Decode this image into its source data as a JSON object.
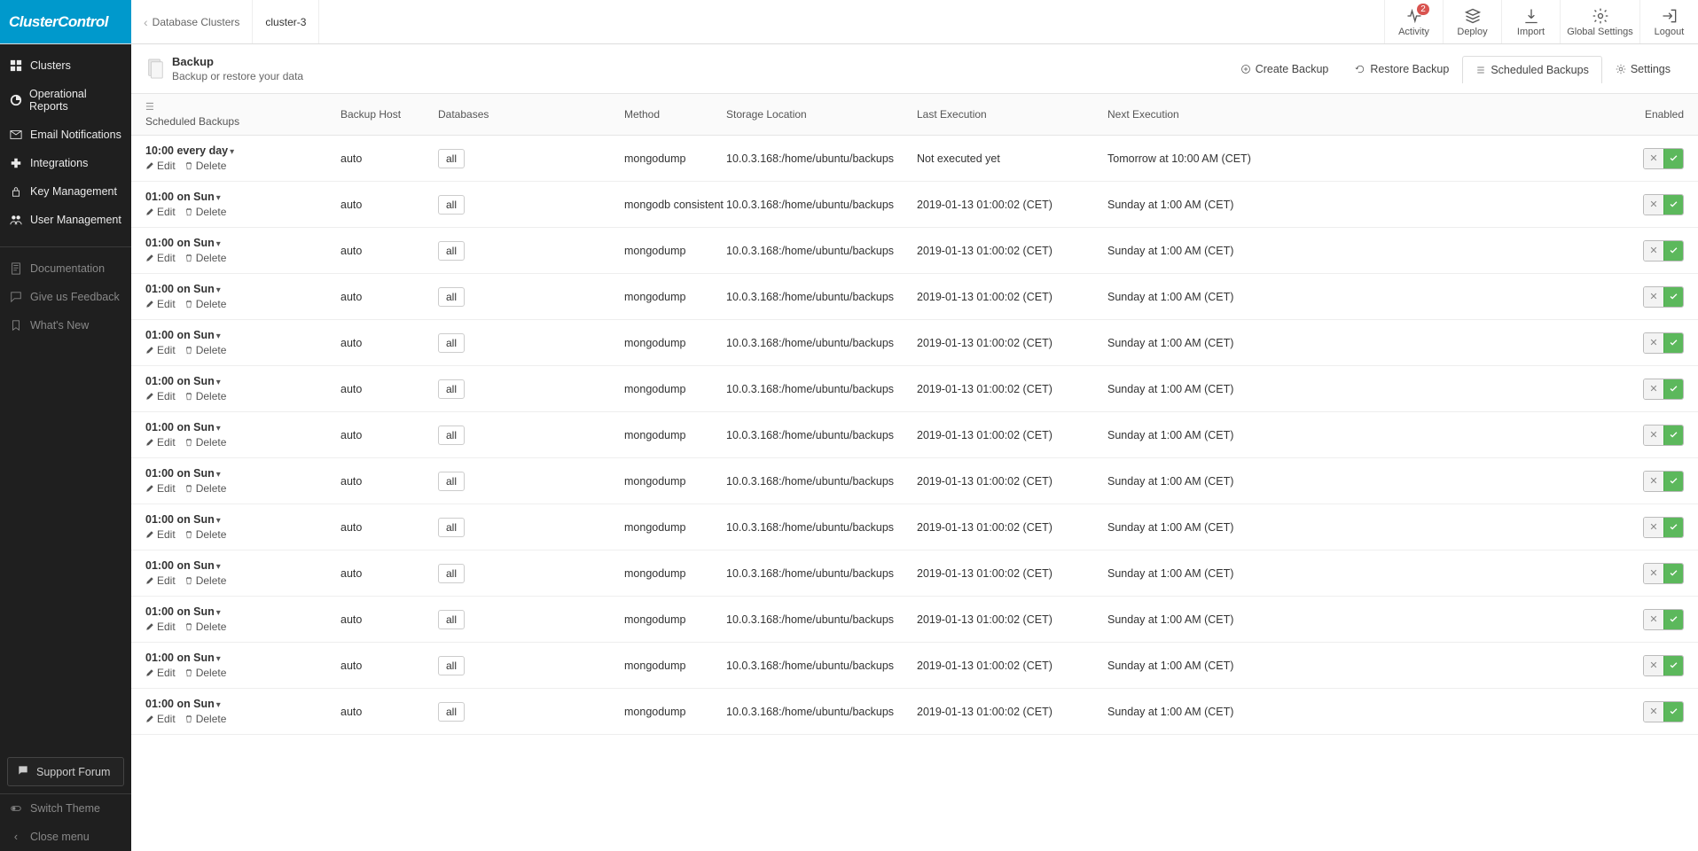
{
  "brand": "ClusterControl",
  "breadcrumb": {
    "back": "Database Clusters",
    "current": "cluster-3"
  },
  "topActions": {
    "activity": "Activity",
    "activityBadge": "2",
    "deploy": "Deploy",
    "import": "Import",
    "globalSettings": "Global Settings",
    "logout": "Logout"
  },
  "sidebar": {
    "primary": [
      {
        "label": "Clusters",
        "icon": "clusters"
      },
      {
        "label": "Operational Reports",
        "icon": "reports"
      },
      {
        "label": "Email Notifications",
        "icon": "email"
      },
      {
        "label": "Integrations",
        "icon": "integrations"
      },
      {
        "label": "Key Management",
        "icon": "key"
      },
      {
        "label": "User Management",
        "icon": "users"
      }
    ],
    "secondary": [
      {
        "label": "Documentation",
        "icon": "doc"
      },
      {
        "label": "Give us Feedback",
        "icon": "feedback"
      },
      {
        "label": "What's New",
        "icon": "new"
      }
    ],
    "supportForum": "Support Forum",
    "switchTheme": "Switch Theme",
    "closeMenu": "Close menu"
  },
  "page": {
    "title": "Backup",
    "subtitle": "Backup or restore your data"
  },
  "tabs": {
    "create": "Create Backup",
    "restore": "Restore Backup",
    "scheduled": "Scheduled Backups",
    "settings": "Settings"
  },
  "table": {
    "headers": {
      "scheduled": "Scheduled Backups",
      "host": "Backup Host",
      "databases": "Databases",
      "method": "Method",
      "storage": "Storage Location",
      "last": "Last Execution",
      "next": "Next Execution",
      "enabled": "Enabled"
    },
    "rowActions": {
      "edit": "Edit",
      "delete": "Delete"
    },
    "rows": [
      {
        "schedule": "10:00 every day",
        "host": "auto",
        "db": "all",
        "method": "mongodump",
        "storage": "10.0.3.168:/home/ubuntu/backups",
        "last": "Not executed yet",
        "next": "Tomorrow at 10:00 AM (CET)"
      },
      {
        "schedule": "01:00 on Sun",
        "host": "auto",
        "db": "all",
        "method": "mongodb consistent",
        "storage": "10.0.3.168:/home/ubuntu/backups",
        "last": "2019-01-13 01:00:02 (CET)",
        "next": "Sunday at 1:00 AM (CET)"
      },
      {
        "schedule": "01:00 on Sun",
        "host": "auto",
        "db": "all",
        "method": "mongodump",
        "storage": "10.0.3.168:/home/ubuntu/backups",
        "last": "2019-01-13 01:00:02 (CET)",
        "next": "Sunday at 1:00 AM (CET)"
      },
      {
        "schedule": "01:00 on Sun",
        "host": "auto",
        "db": "all",
        "method": "mongodump",
        "storage": "10.0.3.168:/home/ubuntu/backups",
        "last": "2019-01-13 01:00:02 (CET)",
        "next": "Sunday at 1:00 AM (CET)"
      },
      {
        "schedule": "01:00 on Sun",
        "host": "auto",
        "db": "all",
        "method": "mongodump",
        "storage": "10.0.3.168:/home/ubuntu/backups",
        "last": "2019-01-13 01:00:02 (CET)",
        "next": "Sunday at 1:00 AM (CET)"
      },
      {
        "schedule": "01:00 on Sun",
        "host": "auto",
        "db": "all",
        "method": "mongodump",
        "storage": "10.0.3.168:/home/ubuntu/backups",
        "last": "2019-01-13 01:00:02 (CET)",
        "next": "Sunday at 1:00 AM (CET)"
      },
      {
        "schedule": "01:00 on Sun",
        "host": "auto",
        "db": "all",
        "method": "mongodump",
        "storage": "10.0.3.168:/home/ubuntu/backups",
        "last": "2019-01-13 01:00:02 (CET)",
        "next": "Sunday at 1:00 AM (CET)"
      },
      {
        "schedule": "01:00 on Sun",
        "host": "auto",
        "db": "all",
        "method": "mongodump",
        "storage": "10.0.3.168:/home/ubuntu/backups",
        "last": "2019-01-13 01:00:02 (CET)",
        "next": "Sunday at 1:00 AM (CET)"
      },
      {
        "schedule": "01:00 on Sun",
        "host": "auto",
        "db": "all",
        "method": "mongodump",
        "storage": "10.0.3.168:/home/ubuntu/backups",
        "last": "2019-01-13 01:00:02 (CET)",
        "next": "Sunday at 1:00 AM (CET)"
      },
      {
        "schedule": "01:00 on Sun",
        "host": "auto",
        "db": "all",
        "method": "mongodump",
        "storage": "10.0.3.168:/home/ubuntu/backups",
        "last": "2019-01-13 01:00:02 (CET)",
        "next": "Sunday at 1:00 AM (CET)"
      },
      {
        "schedule": "01:00 on Sun",
        "host": "auto",
        "db": "all",
        "method": "mongodump",
        "storage": "10.0.3.168:/home/ubuntu/backups",
        "last": "2019-01-13 01:00:02 (CET)",
        "next": "Sunday at 1:00 AM (CET)"
      },
      {
        "schedule": "01:00 on Sun",
        "host": "auto",
        "db": "all",
        "method": "mongodump",
        "storage": "10.0.3.168:/home/ubuntu/backups",
        "last": "2019-01-13 01:00:02 (CET)",
        "next": "Sunday at 1:00 AM (CET)"
      },
      {
        "schedule": "01:00 on Sun",
        "host": "auto",
        "db": "all",
        "method": "mongodump",
        "storage": "10.0.3.168:/home/ubuntu/backups",
        "last": "2019-01-13 01:00:02 (CET)",
        "next": "Sunday at 1:00 AM (CET)"
      }
    ]
  }
}
